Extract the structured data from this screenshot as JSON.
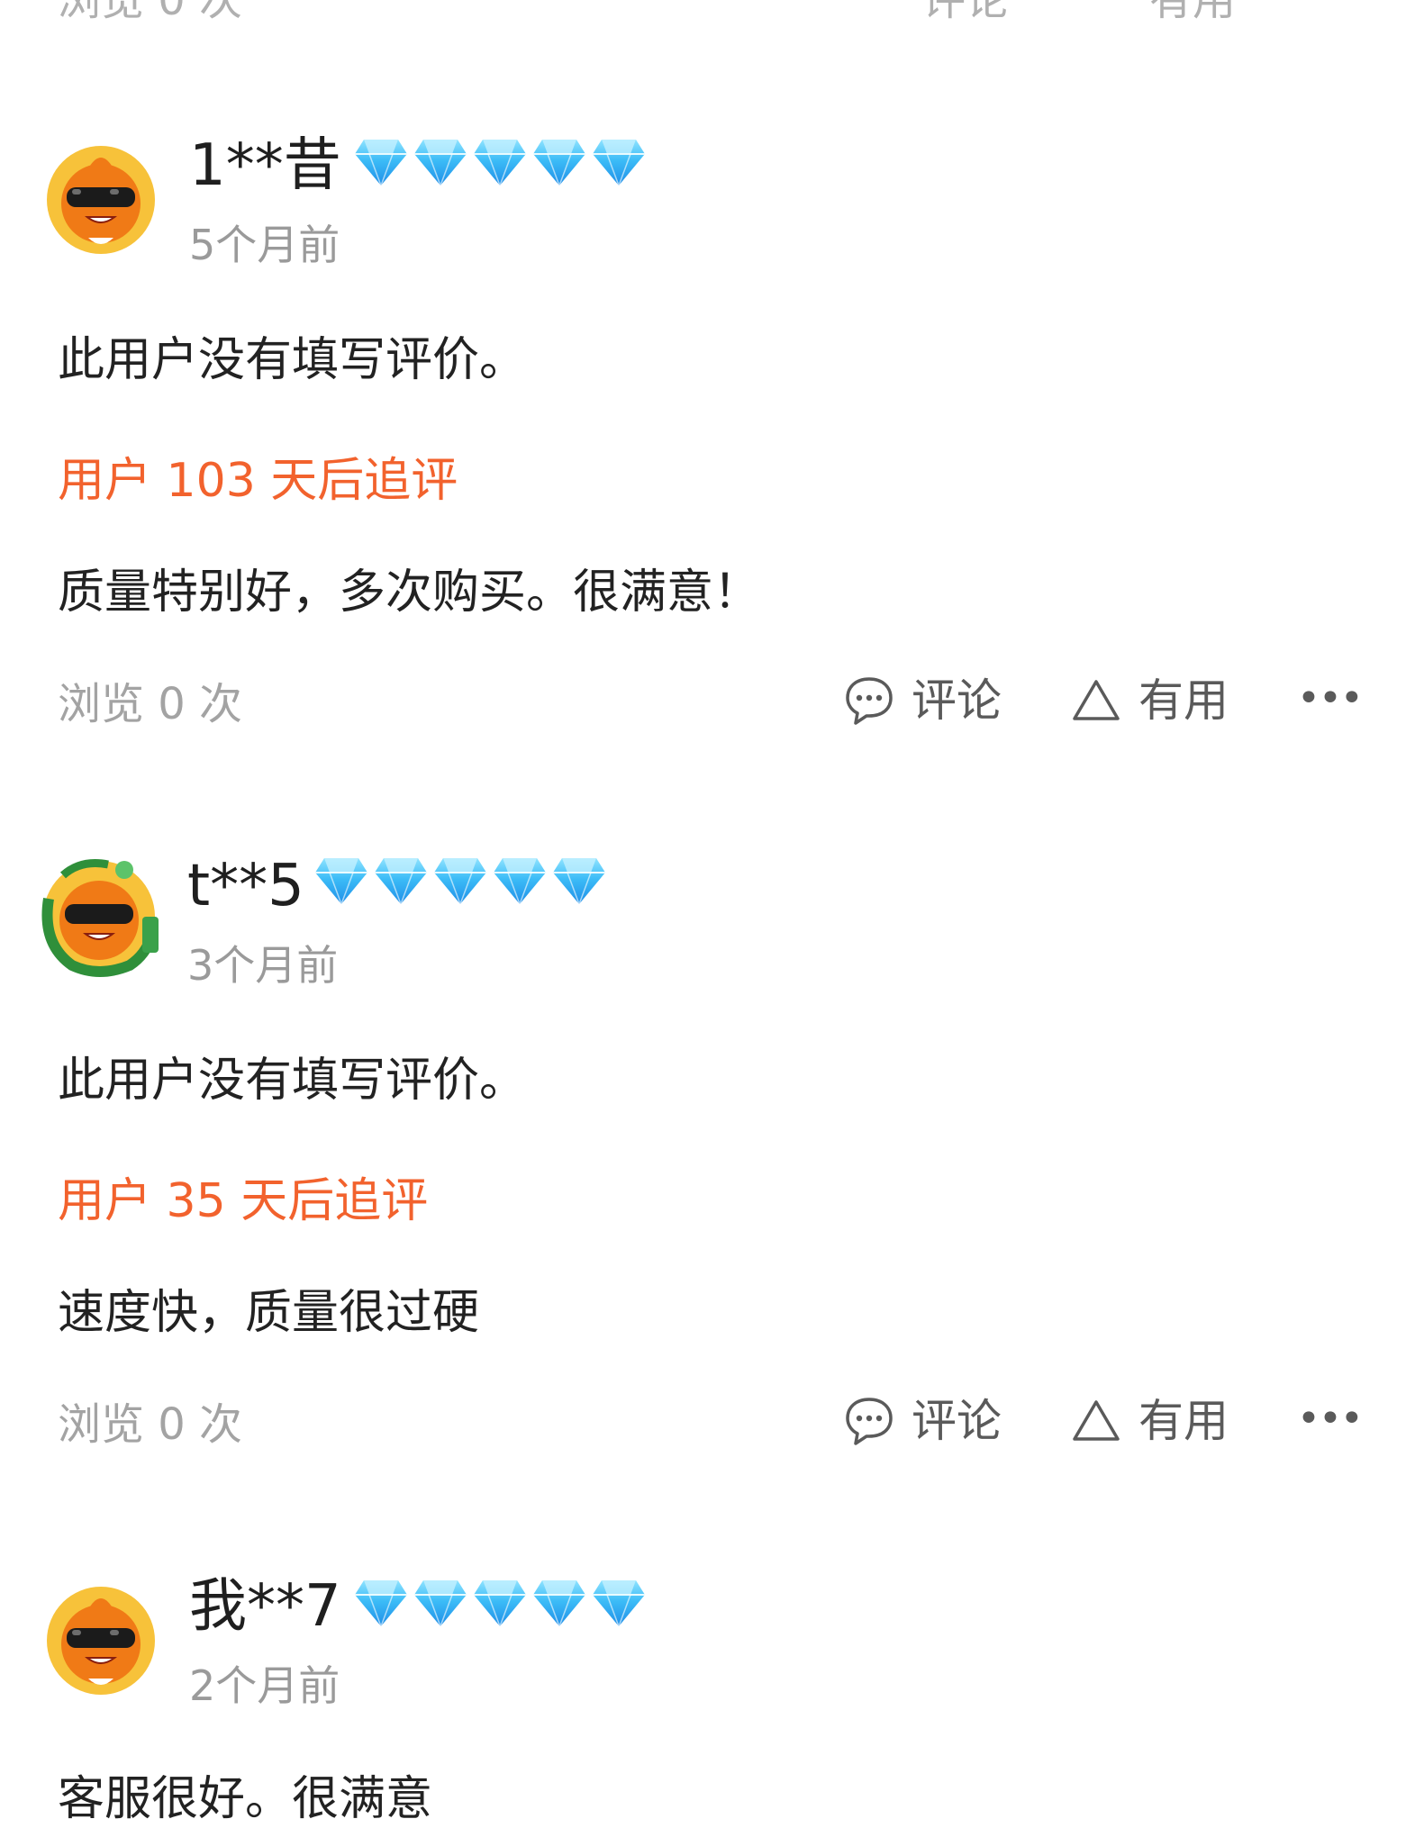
{
  "top_partial": {
    "views": "浏览 0 次",
    "comment": "评论",
    "useful": "有用"
  },
  "reviews": [
    {
      "username": "1**昔",
      "diamonds": 5,
      "time": "5个月前",
      "content": "此用户没有填写评价。",
      "followup_label": "用户 103 天后追评",
      "followup_content": "质量特别好，多次购买。很满意！",
      "views": "浏览 0 次",
      "comment_label": "评论",
      "useful_label": "有用",
      "more_label": "•••"
    },
    {
      "username": "t**5",
      "diamonds": 5,
      "time": "3个月前",
      "content": "此用户没有填写评价。",
      "followup_label": "用户 35 天后追评",
      "followup_content": "速度快，质量很过硬",
      "views": "浏览 0 次",
      "comment_label": "评论",
      "useful_label": "有用",
      "more_label": "•••"
    },
    {
      "username": "我**7",
      "diamonds": 5,
      "time": "2个月前",
      "content": "客服很好。很满意"
    }
  ],
  "colors": {
    "followup": "#f2622d",
    "diamond": "#39b7f5",
    "muted": "#9a9a9a"
  }
}
